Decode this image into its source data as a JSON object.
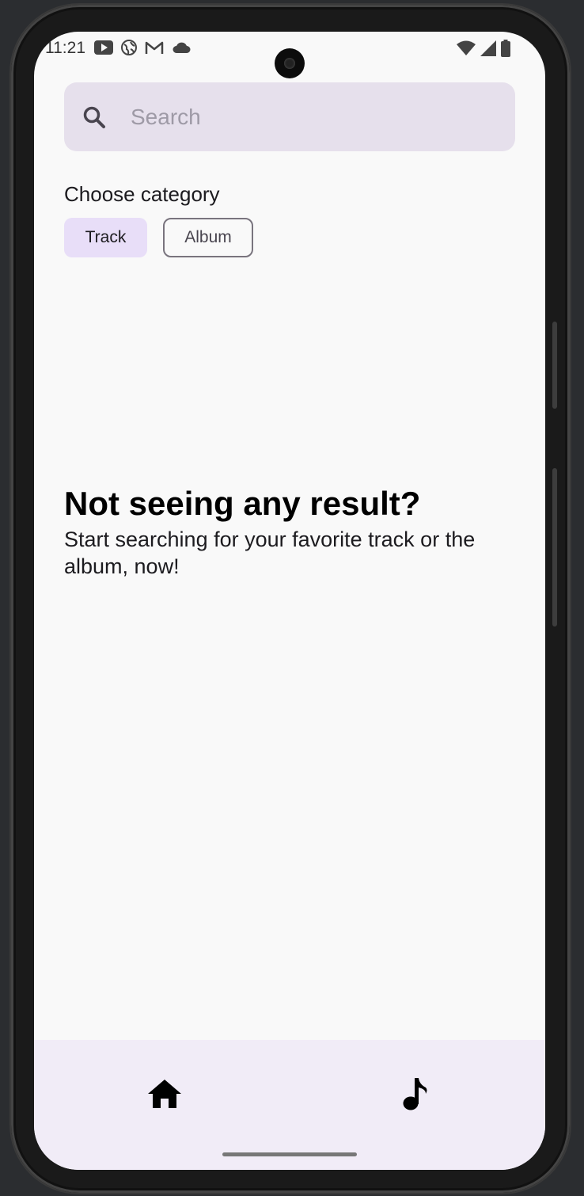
{
  "status_bar": {
    "time": "11:21",
    "left_icons": [
      "youtube-icon",
      "globe-icon",
      "gmail-icon",
      "cloud-icon"
    ],
    "right_icons": [
      "wifi-icon",
      "signal-icon",
      "battery-icon"
    ]
  },
  "search": {
    "placeholder": "Search",
    "value": "",
    "icon": "search-icon"
  },
  "category": {
    "label": "Choose category",
    "chips": [
      {
        "label": "Track",
        "selected": true
      },
      {
        "label": "Album",
        "selected": false
      }
    ]
  },
  "empty_state": {
    "title": "Not seeing any result?",
    "subtitle": "Start searching for your favorite track or the album, now!"
  },
  "bottom_nav": {
    "items": [
      {
        "icon": "home-icon"
      },
      {
        "icon": "music-note-icon"
      }
    ]
  },
  "colors": {
    "background": "#f9f9f9",
    "search_bg": "#e6e0ec",
    "chip_selected_bg": "#e8def8",
    "chip_outline": "#79747e",
    "nav_bg": "#f1ecf7"
  }
}
